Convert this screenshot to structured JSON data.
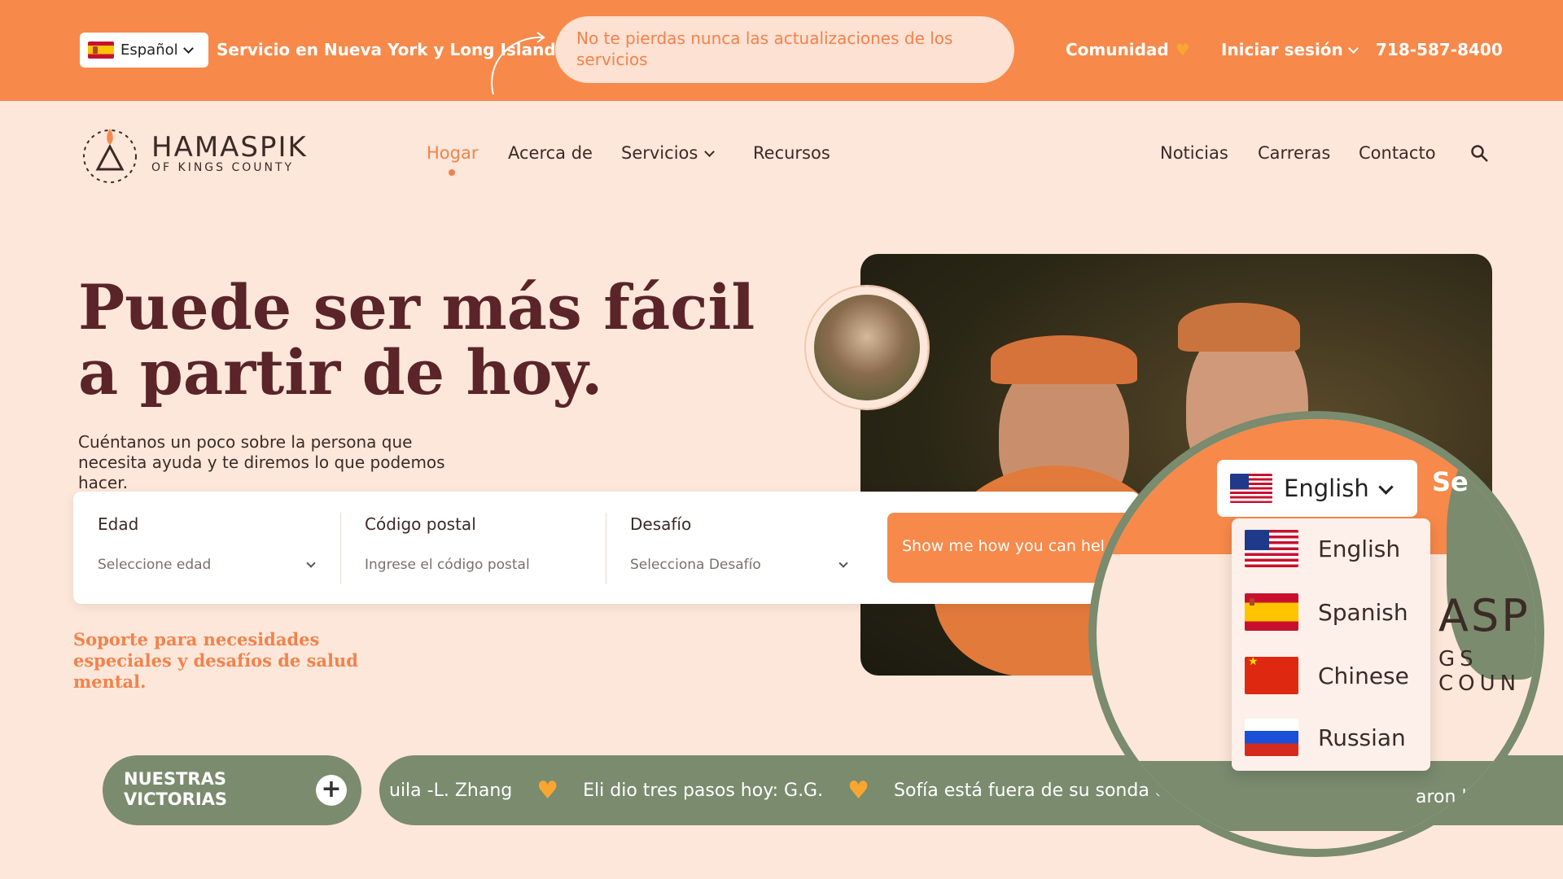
{
  "topbar": {
    "language": "Español",
    "service_area": "Servicio en Nueva York y Long Island",
    "notice": "No te pierdas nunca las actualizaciones de los servicios",
    "community": "Comunidad",
    "login": "Iniciar sesión",
    "phone": "718-587-8400"
  },
  "logo": {
    "name": "HAMASPIK",
    "sub": "OF KINGS COUNTY"
  },
  "nav": {
    "home": "Hogar",
    "about": "Acerca de",
    "services": "Servicios",
    "resources": "Recursos",
    "news": "Noticias",
    "careers": "Carreras",
    "contact": "Contacto"
  },
  "hero": {
    "title": "Puede ser más fácil a partir de hoy.",
    "subtitle": "Cuéntanos un poco sobre la persona que necesita ayuda y te diremos lo que podemos hacer."
  },
  "form": {
    "age_label": "Edad",
    "age_value": "Seleccione edad",
    "zip_label": "Código postal",
    "zip_placeholder": "Ingrese el código postal",
    "challenge_label": "Desafío",
    "challenge_value": "Selecciona Desafío",
    "cta": "Show me how you can hel"
  },
  "support": "Soporte para necesidades especiales y desafíos de salud mental.",
  "victorias": {
    "label": "NUESTRAS VICTORIAS",
    "plus": "+"
  },
  "ticker": [
    "uila -L. Zhang",
    "Eli dio tres pasos hoy: G.G.",
    "Sofía está fuera de su sonda de",
    "aron llegó"
  ],
  "magnifier": {
    "selected": "English",
    "se": "Se",
    "options": [
      "English",
      "Spanish",
      "Chinese",
      "Russian"
    ],
    "logo_fragment": "ASP",
    "logo_sub_fragment": "GS COUN"
  },
  "colors": {
    "accent": "#f7894a",
    "sage": "#7a8b6e",
    "background": "#fde7da",
    "title": "#5a2428"
  }
}
